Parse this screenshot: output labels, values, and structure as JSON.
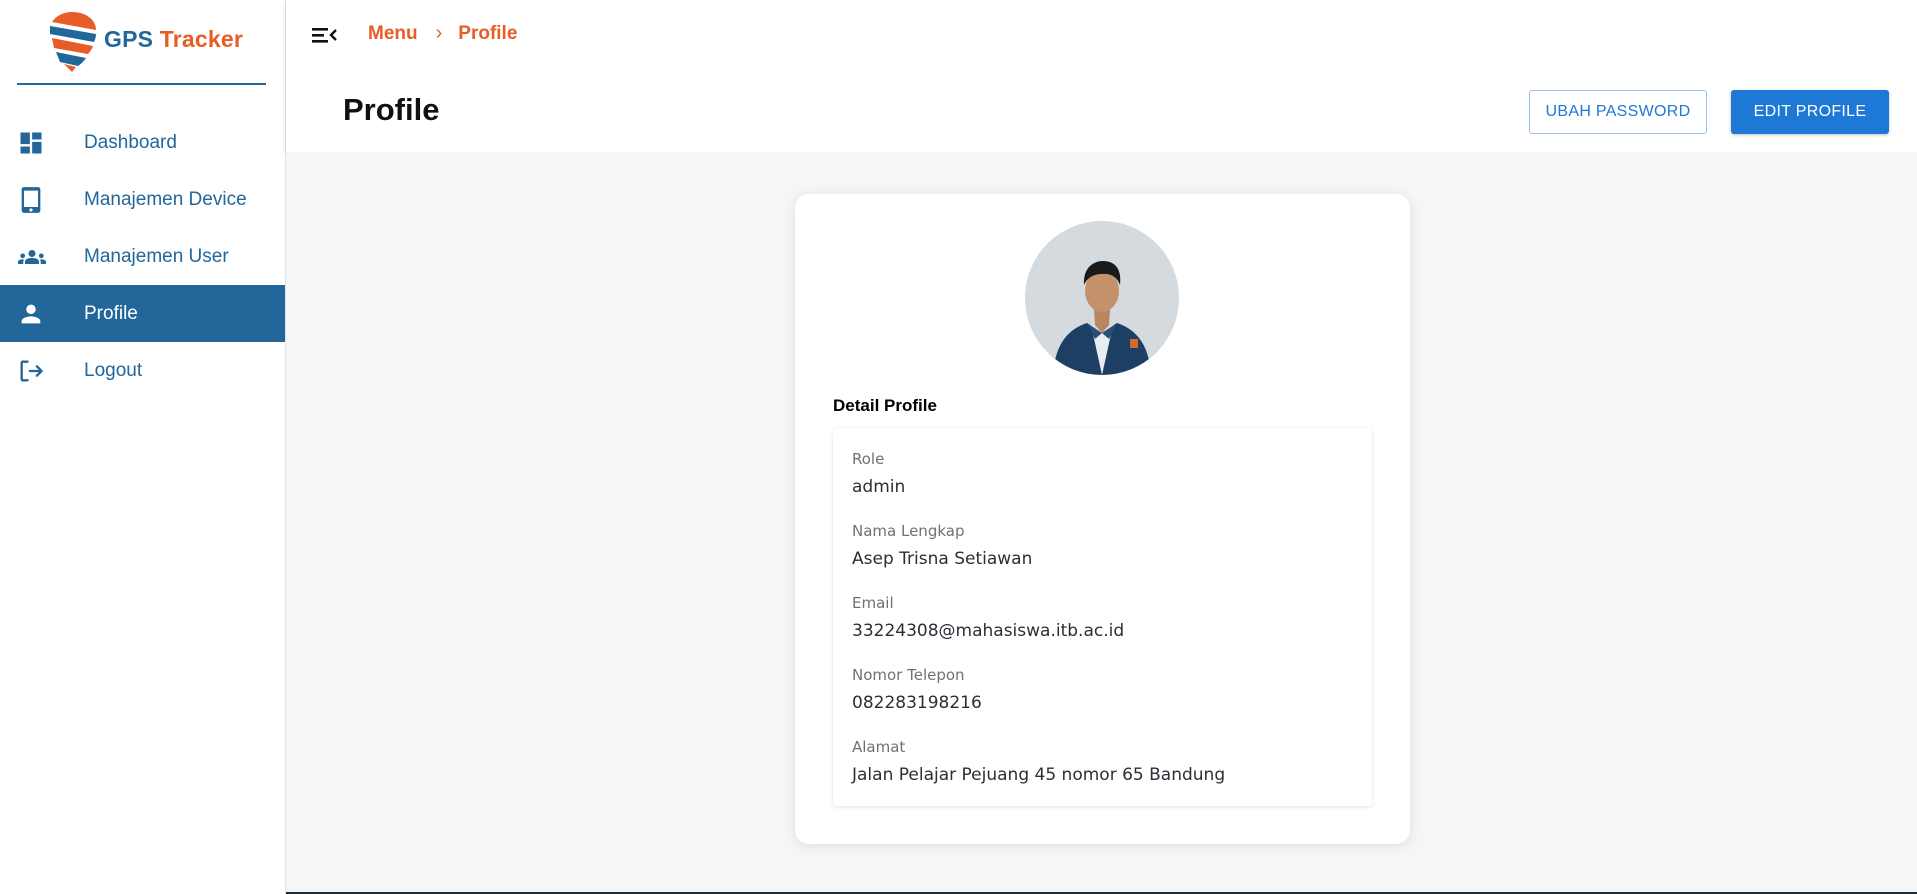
{
  "logo": {
    "gps": "GPS",
    "tracker": "Tracker"
  },
  "sidebar": {
    "items": [
      {
        "label": "Dashboard",
        "icon": "dashboard-icon"
      },
      {
        "label": "Manajemen Device",
        "icon": "tablet-icon"
      },
      {
        "label": "Manajemen User",
        "icon": "group-icon"
      },
      {
        "label": "Profile",
        "icon": "person-icon",
        "active": true
      },
      {
        "label": "Logout",
        "icon": "logout-icon"
      }
    ]
  },
  "header": {
    "breadcrumb": [
      "Menu",
      "Profile"
    ],
    "title": "Profile",
    "ubah_password_label": "UBAH PASSWORD",
    "edit_profile_label": "EDIT PROFILE"
  },
  "profile": {
    "section_title": "Detail Profile",
    "fields": [
      {
        "label": "Role",
        "value": "admin"
      },
      {
        "label": "Nama Lengkap",
        "value": "Asep Trisna Setiawan"
      },
      {
        "label": "Email",
        "value": "33224308@mahasiswa.itb.ac.id"
      },
      {
        "label": "Nomor Telepon",
        "value": "082283198216"
      },
      {
        "label": "Alamat",
        "value": "Jalan Pelajar Pejuang 45 nomor 65 Bandung"
      }
    ]
  },
  "colors": {
    "brand_blue": "#22669a",
    "brand_orange": "#e85d27",
    "button_blue": "#1e78d6"
  }
}
